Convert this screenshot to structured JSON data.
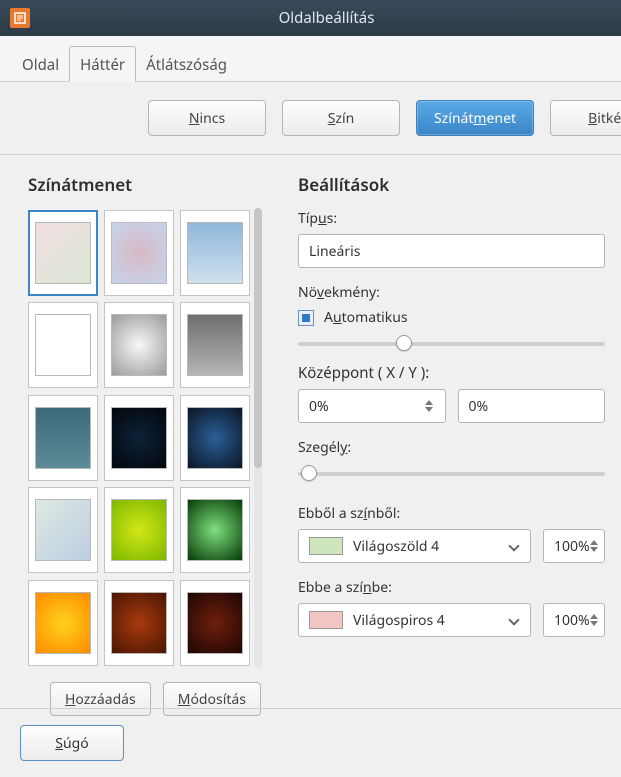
{
  "window": {
    "title": "Oldalbeállítás"
  },
  "tabs": [
    "Oldal",
    "Háttér",
    "Átlátszóság"
  ],
  "fillbar": {
    "none": "Nincs",
    "color": "Szín",
    "gradient": "Színátmenet",
    "bitmap": "Bitkép"
  },
  "left": {
    "title": "Színátmenet",
    "add": "Hozzáadás",
    "modify": "Módosítás"
  },
  "settings": {
    "title": "Beállítások",
    "type_label": "Típus:",
    "type_value": "Lineáris",
    "increment_label": "Növekmény:",
    "automatic": "Automatikus",
    "center_label": "Középpont ( X / Y ):",
    "center_x": "0%",
    "center_y": "0%",
    "border_label": "Szegély:",
    "from_label": "Ebből a színből:",
    "from_color": "Világoszöld 4",
    "from_pct": "100%",
    "to_label": "Ebbe a színbe:",
    "to_color": "Világospiros 4",
    "to_pct": "100%"
  },
  "footer": {
    "help": "Súgó"
  },
  "gradients": [
    {
      "css": "linear-gradient(135deg,#f2dfe0,#d9e6d6)"
    },
    {
      "css": "radial-gradient(circle at 50% 50%,#d7b9c4,#c6d4ec)"
    },
    {
      "css": "linear-gradient(#8fb7da,#cfe0ef)"
    },
    {
      "css": "linear-gradient(#ffffff,#ffffff)"
    },
    {
      "css": "radial-gradient(circle at 50% 50%,#f7f7f7,#9b9b9b)"
    },
    {
      "css": "linear-gradient(#6f6f6f,#b5b5b5)"
    },
    {
      "css": "linear-gradient(#3c6a79,#5d8b98)"
    },
    {
      "css": "radial-gradient(circle at 50% 50%,#0c2138,#04070c)"
    },
    {
      "css": "radial-gradient(circle at 50% 50%,#2b5f96,#0a1526)"
    },
    {
      "css": "linear-gradient(135deg,#dfe9e0,#bccde3)"
    },
    {
      "css": "radial-gradient(circle at 50% 50%,#d2e816,#7db700)"
    },
    {
      "css": "radial-gradient(circle at 50% 50%,#7fe07f,#063a06)"
    },
    {
      "css": "radial-gradient(circle at 50% 50%,#ffd21a,#ff8a00)"
    },
    {
      "css": "radial-gradient(circle at 50% 50%,#a83a0e,#4a1602)"
    },
    {
      "css": "radial-gradient(circle at 50% 50%,#6f1f0c,#1e0603)"
    }
  ],
  "colors": {
    "from_swatch": "#cde6be",
    "to_swatch": "#f3c4c4"
  }
}
